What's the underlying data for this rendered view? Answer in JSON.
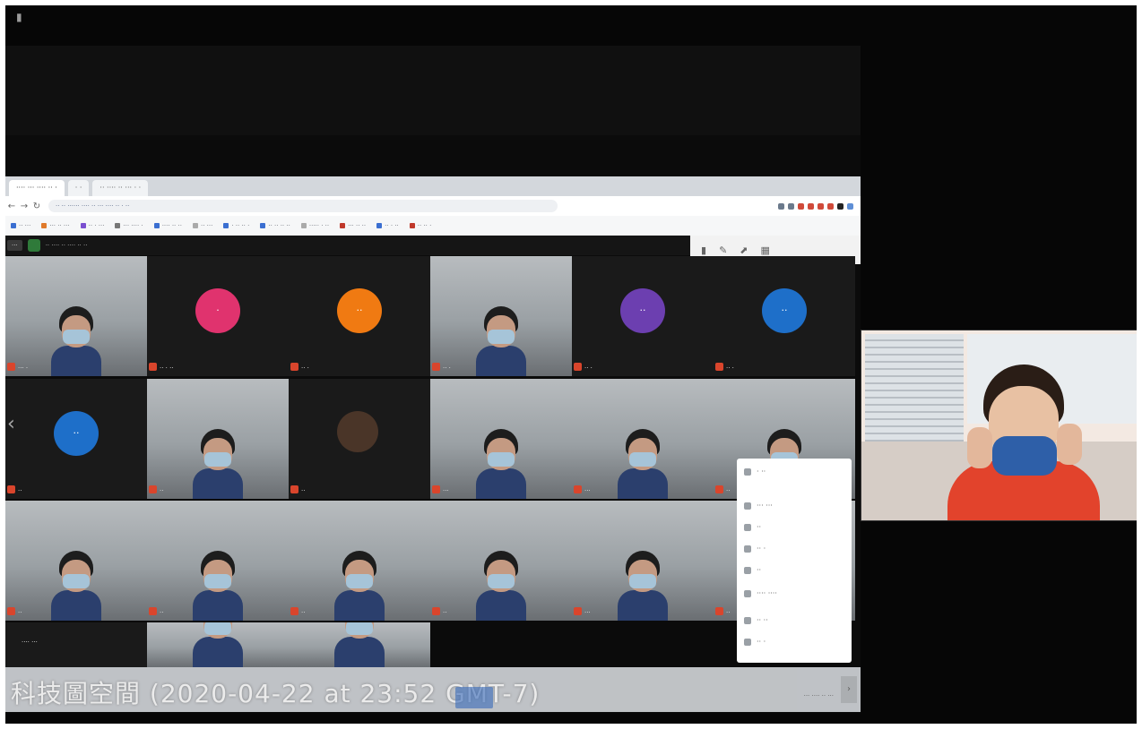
{
  "top_glyph": "▮",
  "browser": {
    "tabs": [
      "···· ··· ···· ·· ·",
      "· ·",
      "·· ···· ·· ··· · ·"
    ],
    "address": "·· ·· ······ ···· ·· ··· ···· ·· · ··",
    "nav": {
      "back": "←",
      "forward": "→",
      "reload": "↻"
    },
    "extension_colors": [
      "#6b7a8c",
      "#6b7a8c",
      "#d04a3a",
      "#d04a3a",
      "#d04a3a",
      "#d04a3a",
      "#222222",
      "#5f8fd6"
    ],
    "bookmarks": [
      {
        "label": "·· ···",
        "color": "#3b6fd1"
      },
      {
        "label": "··· ·· ···",
        "color": "#e07a2b"
      },
      {
        "label": "·· · ···",
        "color": "#7a4fd0"
      },
      {
        "label": "··· ···· ·",
        "color": "#777777"
      },
      {
        "label": "···· ·· ··",
        "color": "#3b6fd1"
      },
      {
        "label": "·· ···",
        "color": "#aaaaaa"
      },
      {
        "label": "· ·· ·· ·",
        "color": "#3b6fd1"
      },
      {
        "label": "·· ·· ·· ··",
        "color": "#3b6fd1"
      },
      {
        "label": "····· · ··",
        "color": "#aaaaaa"
      },
      {
        "label": "··· ·· ··",
        "color": "#c0392b"
      },
      {
        "label": "·· · ··",
        "color": "#3b6fd1"
      },
      {
        "label": "·· ·· ·",
        "color": "#c0392b"
      }
    ]
  },
  "meeting_bar": {
    "pill": "···",
    "title": "·· ···· ·· ···· ·· ··",
    "right_icons": [
      "▮",
      "✎",
      "⬈",
      "▦"
    ]
  },
  "participants": [
    {
      "type": "cam",
      "name": "··· ·"
    },
    {
      "type": "avatar",
      "initials": "·",
      "color": "#e0336e",
      "name": "·· · ··"
    },
    {
      "type": "avatar",
      "initials": "··",
      "color": "#f07a12",
      "name": "·· ·"
    },
    {
      "type": "cam",
      "name": "·· ·"
    },
    {
      "type": "avatar",
      "initials": "··",
      "color": "#6c3fb0",
      "name": "·· ·"
    },
    {
      "type": "avatar",
      "initials": "··",
      "color": "#1e6fc9",
      "name": "·· ·"
    },
    {
      "type": "avatar",
      "initials": "··",
      "color": "#1e6fc9",
      "name": "··"
    },
    {
      "type": "cam",
      "name": "··"
    },
    {
      "type": "dark-self",
      "name": "··"
    },
    {
      "type": "cam",
      "name": "···"
    },
    {
      "type": "cam",
      "name": "···"
    },
    {
      "type": "cam",
      "name": "··"
    },
    {
      "type": "cam",
      "name": "··"
    },
    {
      "type": "cam",
      "name": "··"
    },
    {
      "type": "cam",
      "name": "··"
    },
    {
      "type": "cam",
      "name": "··"
    },
    {
      "type": "cam",
      "name": "···"
    },
    {
      "type": "cam",
      "name": "··"
    },
    {
      "type": "dark",
      "name": "···· ···"
    },
    {
      "type": "cam",
      "name": ""
    },
    {
      "type": "cam",
      "name": ""
    }
  ],
  "popup_menu": [
    "· ··",
    "··· ···",
    "··",
    "·· ·",
    "··",
    "···· ····",
    "·· ··",
    "·· ·"
  ],
  "caption": {
    "text": "科技圖空間 (2020-04-22 at 23:52 GMT-7)",
    "right_text": "··· ···· ·· ···",
    "collapse": "›"
  },
  "prev_arrow": "‹"
}
